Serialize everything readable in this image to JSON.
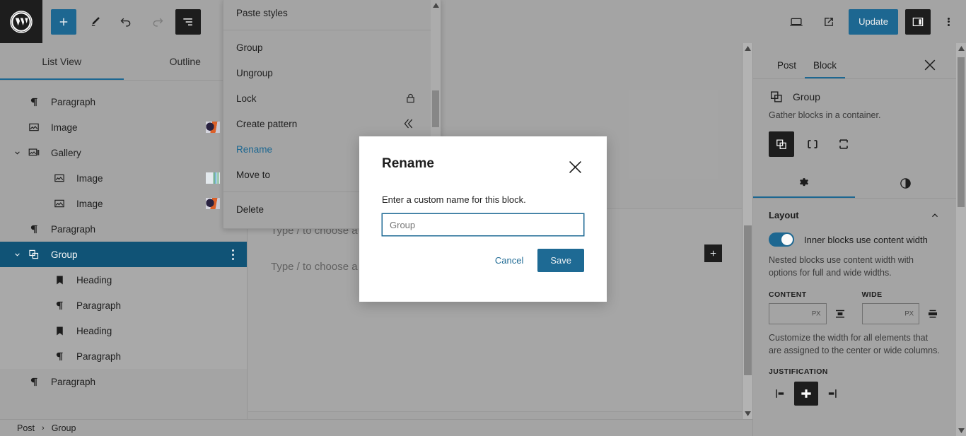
{
  "header": {
    "logo_icon": "wordpress-logo-icon",
    "tools": [
      {
        "name": "add-block-button",
        "icon": "plus-icon",
        "label": "Add block",
        "state": "primary"
      },
      {
        "name": "edit-tool-button",
        "icon": "pencil-icon",
        "label": "Tools",
        "state": "normal"
      },
      {
        "name": "undo-button",
        "icon": "undo-arrow-icon",
        "label": "Undo",
        "state": "normal"
      },
      {
        "name": "redo-button",
        "icon": "redo-arrow-icon",
        "label": "Redo",
        "state": "disabled"
      },
      {
        "name": "list-view-button",
        "icon": "list-view-icon",
        "label": "Document Overview",
        "state": "dark"
      }
    ],
    "view_icon": "desktop-preview-icon",
    "preview_icon": "external-link-icon",
    "update_label": "Update",
    "settings_icon": "settings-sidebar-icon",
    "options_icon": "kebab-menu-icon"
  },
  "list_view": {
    "tabs": [
      {
        "label": "List View",
        "active": true
      },
      {
        "label": "Outline",
        "active": false
      }
    ],
    "rows": [
      {
        "label": "Paragraph",
        "icon": "paragraph-icon",
        "indent": 0,
        "chevron": false,
        "selected": false,
        "nested": false,
        "thumb": null
      },
      {
        "label": "Image",
        "icon": "image-icon",
        "indent": 0,
        "chevron": false,
        "selected": false,
        "nested": false,
        "thumb": "photo"
      },
      {
        "label": "Gallery",
        "icon": "gallery-icon",
        "indent": 0,
        "chevron": true,
        "selected": false,
        "nested": false,
        "thumb": null
      },
      {
        "label": "Image",
        "icon": "image-icon",
        "indent": 1,
        "chevron": false,
        "selected": false,
        "nested": false,
        "thumb": "chart"
      },
      {
        "label": "Image",
        "icon": "image-icon",
        "indent": 1,
        "chevron": false,
        "selected": false,
        "nested": false,
        "thumb": "photo"
      },
      {
        "label": "Paragraph",
        "icon": "paragraph-icon",
        "indent": 0,
        "chevron": false,
        "selected": false,
        "nested": false,
        "thumb": null
      },
      {
        "label": "Group",
        "icon": "group-icon",
        "indent": 0,
        "chevron": true,
        "selected": true,
        "nested": false,
        "thumb": null,
        "more": true
      },
      {
        "label": "Heading",
        "icon": "heading-icon",
        "indent": 1,
        "chevron": false,
        "selected": false,
        "nested": true,
        "thumb": null
      },
      {
        "label": "Paragraph",
        "icon": "paragraph-icon",
        "indent": 1,
        "chevron": false,
        "selected": false,
        "nested": true,
        "thumb": null
      },
      {
        "label": "Heading",
        "icon": "heading-icon",
        "indent": 1,
        "chevron": false,
        "selected": false,
        "nested": true,
        "thumb": null
      },
      {
        "label": "Paragraph",
        "icon": "paragraph-icon",
        "indent": 1,
        "chevron": false,
        "selected": false,
        "nested": true,
        "thumb": null
      },
      {
        "label": "Paragraph",
        "icon": "paragraph-icon",
        "indent": 0,
        "chevron": false,
        "selected": false,
        "nested": false,
        "thumb": null
      }
    ]
  },
  "breadcrumb": {
    "items": [
      "Post",
      "Group"
    ],
    "separator": "›"
  },
  "canvas": {
    "paragraphs": [
      "Type / to choose a block",
      "Type / to choose a block"
    ],
    "inserter_icon": "plus-icon"
  },
  "dropdown": {
    "groups": [
      [
        {
          "label": "Paste styles",
          "icon": null,
          "accent": false
        }
      ],
      [
        {
          "label": "Group",
          "icon": null,
          "accent": false
        },
        {
          "label": "Ungroup",
          "icon": null,
          "accent": false
        },
        {
          "label": "Lock",
          "icon": "lock-icon",
          "accent": false
        },
        {
          "label": "Create pattern",
          "icon": "pattern-icon",
          "accent": false
        },
        {
          "label": "Rename",
          "icon": null,
          "accent": true
        },
        {
          "label": "Move to",
          "icon": null,
          "accent": false
        }
      ],
      [
        {
          "label": "Delete",
          "icon": null,
          "accent": false
        }
      ]
    ]
  },
  "modal": {
    "title": "Rename",
    "close_icon": "close-icon",
    "description": "Enter a custom name for this block.",
    "input_placeholder": "Group",
    "input_value": "",
    "cancel_label": "Cancel",
    "save_label": "Save"
  },
  "sidebar": {
    "tabs": [
      {
        "label": "Post",
        "active": false
      },
      {
        "label": "Block",
        "active": true
      }
    ],
    "close_icon": "close-icon",
    "block": {
      "icon": "group-icon",
      "title": "Group",
      "description": "Gather blocks in a container.",
      "variations": [
        {
          "name": "group",
          "icon": "group-variation-icon",
          "active": true
        },
        {
          "name": "row",
          "icon": "row-variation-icon",
          "active": false
        },
        {
          "name": "stack",
          "icon": "stack-variation-icon",
          "active": false
        }
      ]
    },
    "icon_tabs": [
      {
        "name": "settings",
        "icon": "gear-icon",
        "active": true
      },
      {
        "name": "styles",
        "icon": "contrast-icon",
        "active": false
      }
    ],
    "layout": {
      "panel_title": "Layout",
      "collapse_icon": "chevron-up-icon",
      "toggle_label": "Inner blocks use content width",
      "toggle_on": true,
      "help_text": "Nested blocks use content width with options for full and wide widths.",
      "content_label": "Content",
      "content_value": "",
      "content_unit": "px",
      "content_align_icon": "align-content-icon",
      "wide_label": "Wide",
      "wide_value": "",
      "wide_unit": "px",
      "wide_align_icon": "align-wide-icon",
      "width_help": "Customize the width for all elements that are assigned to the center or wide columns.",
      "justification_label": "Justification",
      "justification_options": [
        {
          "name": "justify-left",
          "icon": "justify-left-icon",
          "active": false
        },
        {
          "name": "justify-center",
          "icon": "justify-center-icon",
          "active": true
        },
        {
          "name": "justify-right",
          "icon": "justify-right-icon",
          "active": false
        }
      ]
    }
  },
  "colors": {
    "accent": "#1e6a94",
    "selected_row": "#115579",
    "chrome": "#a8a8a8",
    "dark": "#1e1e1e",
    "modal_bg": "#ffffff"
  }
}
